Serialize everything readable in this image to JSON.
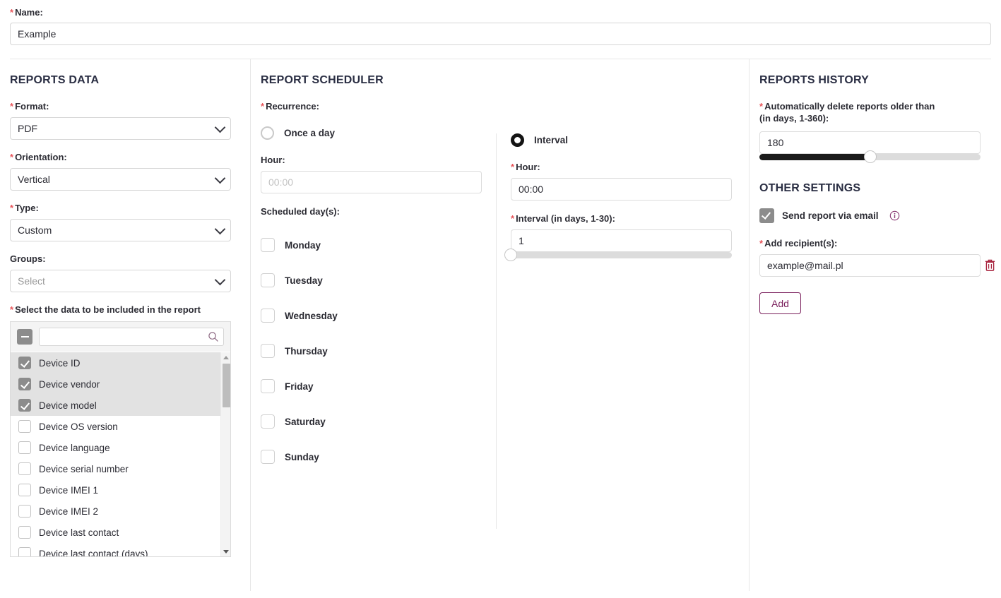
{
  "form": {
    "name_label": "Name:",
    "name_value": "Example"
  },
  "reports_data": {
    "title": "REPORTS DATA",
    "format_label": "Format:",
    "format_value": "PDF",
    "orientation_label": "Orientation:",
    "orientation_value": "Vertical",
    "type_label": "Type:",
    "type_value": "Custom",
    "groups_label": "Groups:",
    "groups_value": "Select",
    "select_data_label": "Select the data to be included in the report",
    "search_value": "",
    "search_placeholder": "",
    "search_icon": "search-icon",
    "tristate_icon": "indeterminate-checkbox-icon",
    "options": [
      {
        "label": "Device ID",
        "checked": true
      },
      {
        "label": "Device vendor",
        "checked": true
      },
      {
        "label": "Device model",
        "checked": true
      },
      {
        "label": "Device OS version",
        "checked": false
      },
      {
        "label": "Device language",
        "checked": false
      },
      {
        "label": "Device serial number",
        "checked": false
      },
      {
        "label": "Device IMEI 1",
        "checked": false
      },
      {
        "label": "Device IMEI 2",
        "checked": false
      },
      {
        "label": "Device last contact",
        "checked": false
      },
      {
        "label": "Device last contact (days)",
        "checked": false
      }
    ]
  },
  "scheduler": {
    "title": "REPORT SCHEDULER",
    "recurrence_label": "Recurrence:",
    "once_a_day": {
      "radio_label": "Once a day",
      "selected": false,
      "hour_label": "Hour:",
      "hour_value": "",
      "hour_placeholder": "00:00",
      "scheduled_days_label": "Scheduled day(s):",
      "days": [
        {
          "label": "Monday",
          "checked": false
        },
        {
          "label": "Tuesday",
          "checked": false
        },
        {
          "label": "Wednesday",
          "checked": false
        },
        {
          "label": "Thursday",
          "checked": false
        },
        {
          "label": "Friday",
          "checked": false
        },
        {
          "label": "Saturday",
          "checked": false
        },
        {
          "label": "Sunday",
          "checked": false
        }
      ]
    },
    "interval": {
      "radio_label": "Interval",
      "selected": true,
      "hour_label": "Hour:",
      "hour_value": "00:00",
      "interval_label": "Interval (in days, 1-30):",
      "interval_value": "1",
      "slider_min": 1,
      "slider_max": 30,
      "slider_percent": 0
    }
  },
  "history": {
    "title": "REPORTS HISTORY",
    "delete_label_line1": "Automatically delete reports older than",
    "delete_label_line2": "(in days, 1-360):",
    "delete_value": "180",
    "slider_min": 1,
    "slider_max": 360,
    "slider_percent": 50
  },
  "other_settings": {
    "title": "OTHER SETTINGS",
    "send_email_label": "Send report via email",
    "send_email_checked": true,
    "info_icon": "info-icon",
    "add_recipients_label": "Add recipient(s):",
    "recipient_value": "example@mail.pl",
    "delete_icon": "trash-icon",
    "add_button_label": "Add"
  },
  "colors": {
    "required_star": "#e8565b",
    "accent_purple": "#7a1f5c",
    "heading": "#2a2e43",
    "slider_fill": "#1b1b1b",
    "checkbox_checked": "#8c8c8c"
  }
}
